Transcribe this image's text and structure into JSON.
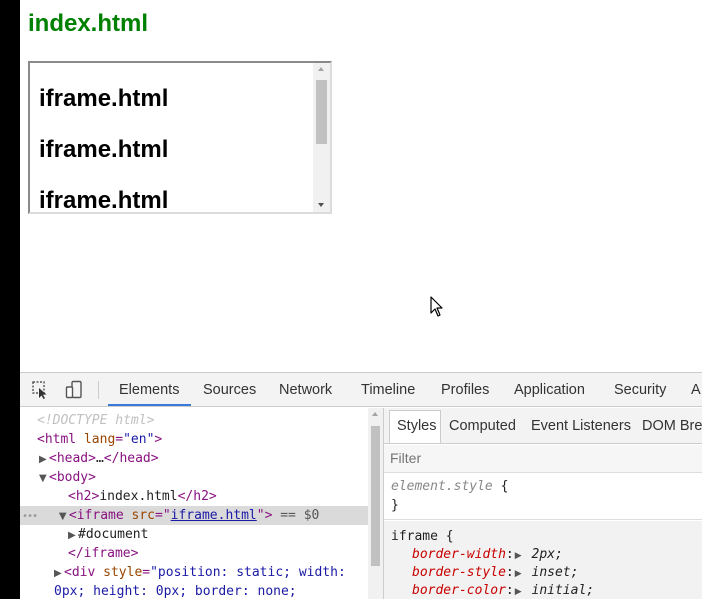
{
  "page": {
    "heading": "index.html",
    "iframe_lines": [
      "iframe.html",
      "iframe.html",
      "iframe.html"
    ]
  },
  "devtools": {
    "tool_icons": [
      "inspect-element-icon",
      "device-toolbar-icon"
    ],
    "tabs": [
      {
        "label": "Elements",
        "active": true
      },
      {
        "label": "Sources"
      },
      {
        "label": "Network"
      },
      {
        "label": "Timeline"
      },
      {
        "label": "Profiles"
      },
      {
        "label": "Application"
      },
      {
        "label": "Security"
      },
      {
        "label": "A"
      }
    ],
    "dom_tree": {
      "doctype": "<!DOCTYPE html>",
      "html_open_tag": "html",
      "html_attr_name": "lang",
      "html_attr_value": "\"en\"",
      "head_tag": "<head>",
      "head_ellipsis": "…",
      "head_close": "</head>",
      "body_tag": "<body>",
      "h2_open": "<h2>",
      "h2_text": "index.html",
      "h2_close": "</h2>",
      "selected_dots": "•••",
      "iframe_tag": "iframe",
      "iframe_attr_name": "src",
      "iframe_attr_value": "iframe.html",
      "selected_marker": "== $0",
      "document_node": "#document",
      "iframe_close": "</iframe>",
      "div_tag": "div",
      "div_attr_name": "style",
      "div_attr_value_line1": "\"position: static; width:",
      "div_attr_value_line2": "0px; height: 0px; border: none;"
    },
    "styles": {
      "tabs": [
        {
          "label": "Styles",
          "active": true
        },
        {
          "label": "Computed"
        },
        {
          "label": "Event Listeners"
        },
        {
          "label": "DOM Bre"
        }
      ],
      "filter_placeholder": "Filter",
      "element_style": {
        "selector": "element.style",
        "open_brace": "{",
        "close_brace": "}"
      },
      "iframe_rule": {
        "selector": "iframe",
        "open_brace": "{",
        "declarations": [
          {
            "property": "border-width",
            "value": "2px;"
          },
          {
            "property": "border-style",
            "value": "inset;"
          },
          {
            "property": "border-color",
            "value": "initial;"
          }
        ]
      }
    }
  },
  "colors": {
    "heading_green": "#008000",
    "tab_accent": "#3879d9",
    "tag_purple": "#881280",
    "attr_brown": "#994500",
    "value_blue": "#1a1aa6",
    "css_prop_red": "#c80000"
  }
}
